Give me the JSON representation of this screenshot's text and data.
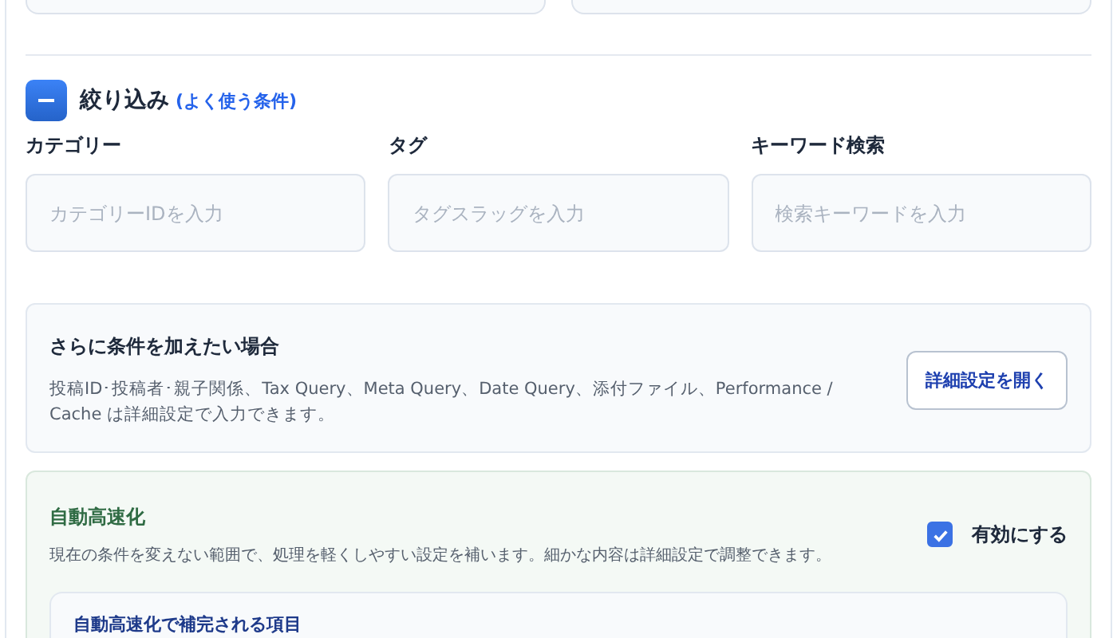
{
  "filter": {
    "title": "絞り込み",
    "subtitle": "(よく使う条件)",
    "expanded": true,
    "fields": [
      {
        "label": "カテゴリー",
        "placeholder": "カテゴリーIDを入力"
      },
      {
        "label": "タグ",
        "placeholder": "タグスラッグを入力"
      },
      {
        "label": "キーワード検索",
        "placeholder": "検索キーワードを入力"
      }
    ]
  },
  "advanced": {
    "title": "さらに条件を加えたい場合",
    "description": "投稿ID･投稿者･親子関係、Tax Query、Meta Query、Date Query、添付ファイル、Performance / Cache は詳細設定で入力できます。",
    "button": "詳細設定を開く"
  },
  "auto_speed": {
    "title": "自動高速化",
    "description": "現在の条件を変えない範囲で、処理を軽くしやすい設定を補います。細かな内容は詳細設定で調整できます。",
    "checkbox": {
      "label": "有効にする",
      "checked": true
    },
    "inner_title": "自動高速化で補完される項目"
  }
}
